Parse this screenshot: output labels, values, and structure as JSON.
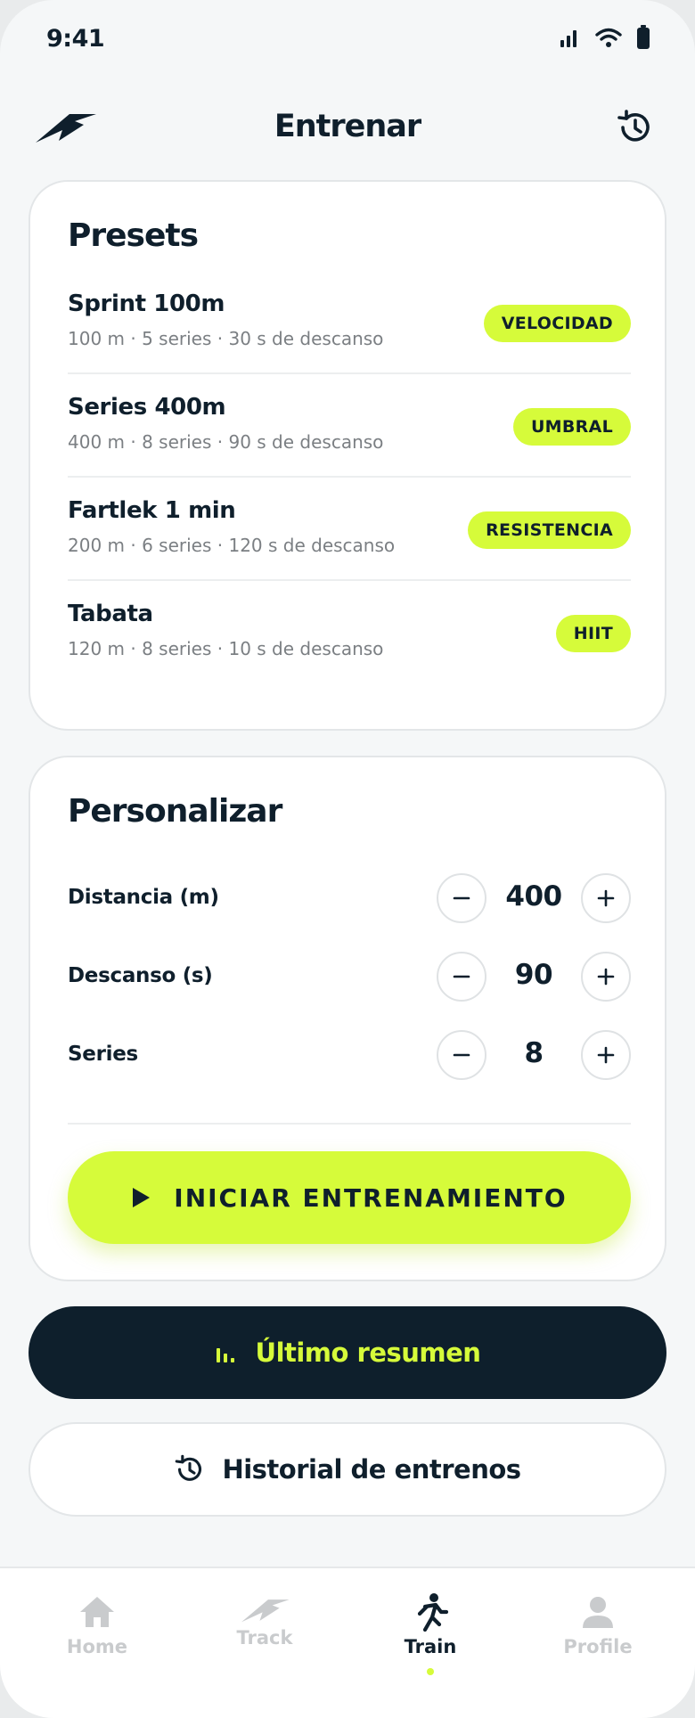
{
  "status": {
    "time": "9:41"
  },
  "header": {
    "title": "Entrenar"
  },
  "presets": {
    "title": "Presets",
    "items": [
      {
        "name": "Sprint 100m",
        "desc": "100 m · 5 series · 30 s de descanso",
        "tag": "VELOCIDAD"
      },
      {
        "name": "Series 400m",
        "desc": "400 m · 8 series · 90 s de descanso",
        "tag": "UMBRAL"
      },
      {
        "name": "Fartlek 1 min",
        "desc": "200 m · 6 series · 120 s de descanso",
        "tag": "RESISTENCIA"
      },
      {
        "name": "Tabata",
        "desc": "120 m · 8 series · 10 s de descanso",
        "tag": "HIIT"
      }
    ]
  },
  "custom": {
    "title": "Personalizar",
    "rows": [
      {
        "label": "Distancia (m)",
        "value": "400"
      },
      {
        "label": "Descanso (s)",
        "value": "90"
      },
      {
        "label": "Series",
        "value": "8"
      }
    ],
    "start_label": "INICIAR ENTRENAMIENTO"
  },
  "actions": {
    "summary_label": "Último resumen",
    "history_label": "Historial de entrenos"
  },
  "nav": {
    "items": [
      {
        "label": "Home",
        "icon": "home-icon"
      },
      {
        "label": "Track",
        "icon": "track-icon"
      },
      {
        "label": "Train",
        "icon": "runner-icon",
        "active": true
      },
      {
        "label": "Profile",
        "icon": "person-icon"
      }
    ]
  },
  "colors": {
    "accent": "#d6fb3a",
    "dark": "#0e1f2c",
    "muted": "#c9cbcd"
  }
}
